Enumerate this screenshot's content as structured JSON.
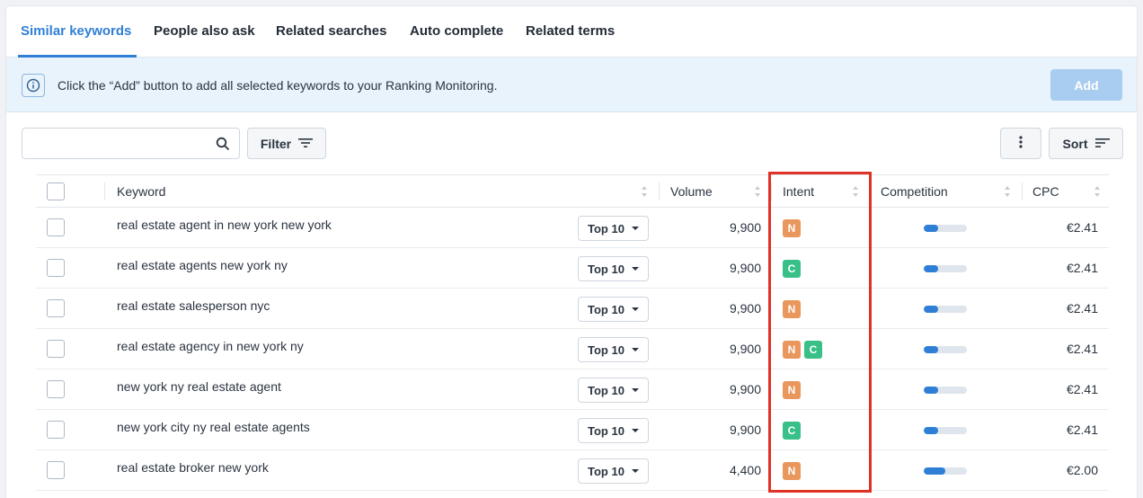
{
  "tabs": [
    {
      "label": "Similar keywords",
      "active": true
    },
    {
      "label": "People also ask",
      "active": false
    },
    {
      "label": "Related searches",
      "active": false
    },
    {
      "label": "Auto complete",
      "active": false
    },
    {
      "label": "Related terms",
      "active": false
    }
  ],
  "banner": {
    "text": "Click the “Add” button to add all selected keywords to your Ranking Monitoring.",
    "add_label": "Add"
  },
  "toolbar": {
    "search_value": "",
    "filter_label": "Filter",
    "sort_label": "Sort"
  },
  "table": {
    "headers": {
      "keyword": "Keyword",
      "volume": "Volume",
      "intent": "Intent",
      "competition": "Competition",
      "cpc": "CPC"
    },
    "rows": [
      {
        "keyword": "real estate agent in new york new york",
        "rank": "Top 10",
        "volume": "9,900",
        "intent": [
          "N"
        ],
        "competition": 0.33,
        "cpc": "€2.41"
      },
      {
        "keyword": "real estate agents new york ny",
        "rank": "Top 10",
        "volume": "9,900",
        "intent": [
          "C"
        ],
        "competition": 0.33,
        "cpc": "€2.41"
      },
      {
        "keyword": "real estate salesperson nyc",
        "rank": "Top 10",
        "volume": "9,900",
        "intent": [
          "N"
        ],
        "competition": 0.33,
        "cpc": "€2.41"
      },
      {
        "keyword": "real estate agency in new york ny",
        "rank": "Top 10",
        "volume": "9,900",
        "intent": [
          "N",
          "C"
        ],
        "competition": 0.33,
        "cpc": "€2.41"
      },
      {
        "keyword": "new york ny real estate agent",
        "rank": "Top 10",
        "volume": "9,900",
        "intent": [
          "N"
        ],
        "competition": 0.33,
        "cpc": "€2.41"
      },
      {
        "keyword": "new york city ny real estate agents",
        "rank": "Top 10",
        "volume": "9,900",
        "intent": [
          "C"
        ],
        "competition": 0.33,
        "cpc": "€2.41"
      },
      {
        "keyword": "real estate broker new york",
        "rank": "Top 10",
        "volume": "4,400",
        "intent": [
          "N"
        ],
        "competition": 0.5,
        "cpc": "€2.00"
      }
    ]
  },
  "colors": {
    "accent": "#2f7fd6",
    "intent_N": "#e9975c",
    "intent_C": "#39c089",
    "highlight": "#e03127"
  }
}
